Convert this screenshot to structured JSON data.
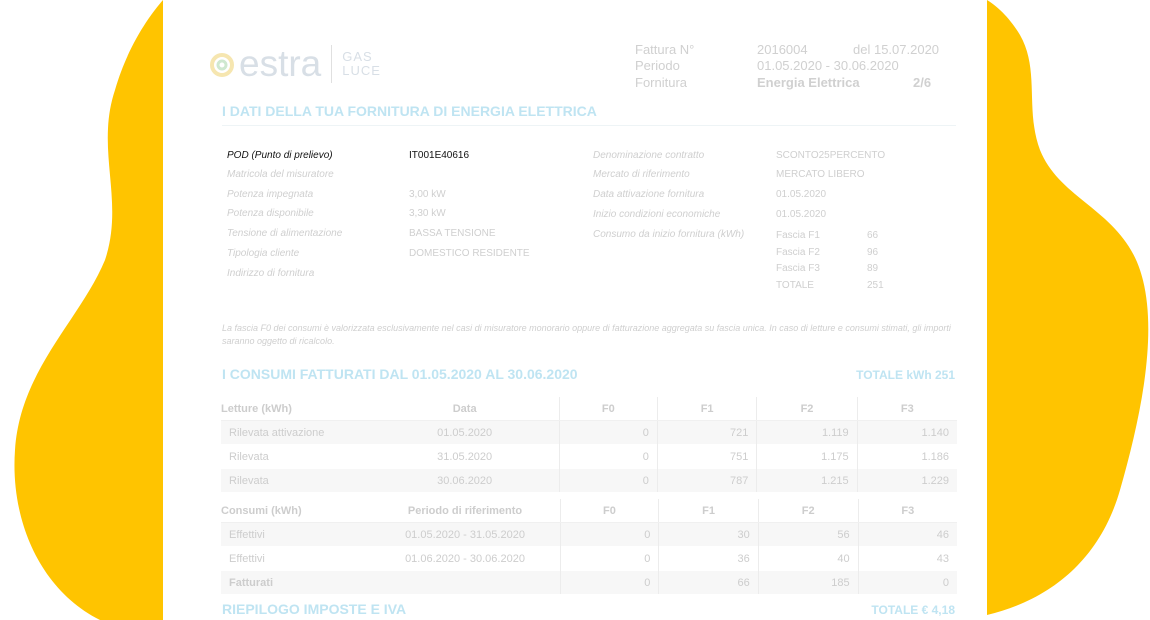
{
  "brand": {
    "name": "estra",
    "sub_line1": "GAS",
    "sub_line2": "LUCE",
    "color_blob": "#FFC400",
    "color_accent": "#bfe4f2"
  },
  "header": {
    "invoice_label": "Fattura N°",
    "invoice_number": "2016004",
    "invoice_date": "del 15.07.2020",
    "period_label": "Periodo",
    "period_value": "01.05.2020 - 30.06.2020",
    "supply_label": "Fornitura",
    "supply_value": "Energia Elettrica",
    "page": "2/6"
  },
  "section_supply": {
    "title": "I DATI DELLA TUA FORNITURA DI ENERGIA ELETTRICA",
    "left_labels": [
      "POD (Punto di prelievo)",
      "Matricola del misuratore",
      "Potenza impegnata",
      "Potenza disponibile",
      "Tensione di alimentazione",
      "Tipologia cliente",
      "Indirizzo di fornitura"
    ],
    "left_values": [
      "IT001E40616",
      "",
      "3,00 kW",
      "3,30 kW",
      "BASSA TENSIONE",
      "DOMESTICO RESIDENTE",
      ""
    ],
    "right_labels": [
      "Denominazione contratto",
      "Mercato di riferimento",
      "Data attivazione fornitura",
      "Inizio condizioni economiche",
      "Consumo da inizio fornitura (kWh)"
    ],
    "right_values": [
      "SCONTO25PERCENTO",
      "MERCATO LIBERO",
      "01.05.2020",
      "01.05.2020"
    ],
    "bands": [
      {
        "name": "Fascia F1",
        "value": "66"
      },
      {
        "name": "Fascia F2",
        "value": "96"
      },
      {
        "name": "Fascia F3",
        "value": "89"
      },
      {
        "name": "TOTALE",
        "value": "251"
      }
    ],
    "note": "La fascia F0 dei consumi è valorizzata esclusivamente nel casi di misuratore monorario oppure di fatturazione aggregata su fascia unica. In caso di letture e consumi stimati, gli importi saranno oggetto di ricalcolo."
  },
  "section_consumption": {
    "title": "I CONSUMI FATTURATI DAL 01.05.2020  AL  30.06.2020",
    "total": "TOTALE kWh 251",
    "readings_headers": [
      "Letture (kWh)",
      "Data",
      "F0",
      "F1",
      "F2",
      "F3"
    ],
    "readings_rows": [
      [
        "Rilevata attivazione",
        "01.05.2020",
        "0",
        "721",
        "1.119",
        "1.140"
      ],
      [
        "Rilevata",
        "31.05.2020",
        "0",
        "751",
        "1.175",
        "1.186"
      ],
      [
        "Rilevata",
        "30.06.2020",
        "0",
        "787",
        "1.215",
        "1.229"
      ]
    ],
    "consumption_headers": [
      "Consumi (kWh)",
      "Periodo di riferimento",
      "F0",
      "F1",
      "F2",
      "F3"
    ],
    "consumption_rows": [
      [
        "Effettivi",
        "01.05.2020 - 31.05.2020",
        "0",
        "30",
        "56",
        "46"
      ],
      [
        "Effettivi",
        "01.06.2020 - 30.06.2020",
        "0",
        "36",
        "40",
        "43"
      ],
      [
        "Fatturati",
        "",
        "0",
        "66",
        "185",
        "0"
      ]
    ]
  },
  "section_taxes": {
    "title": "RIEPILOGO IMPOSTE E IVA",
    "total": "TOTALE € 4,18"
  }
}
